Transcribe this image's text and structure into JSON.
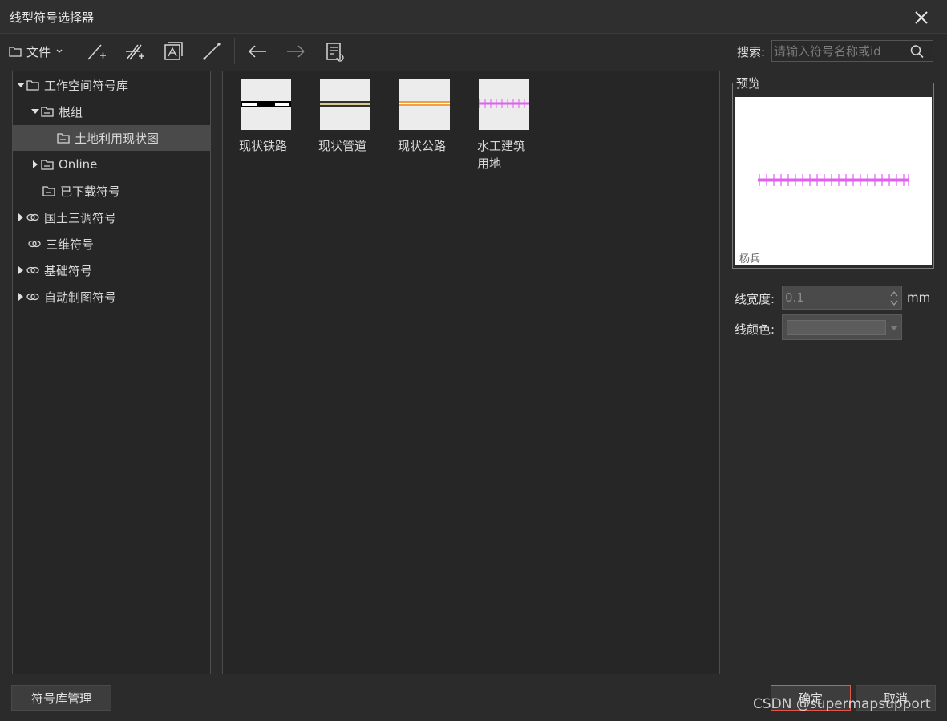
{
  "window": {
    "title": "线型符号选择器",
    "close_icon": "close-icon"
  },
  "toolbar": {
    "file_label": "文件",
    "icons": [
      "new-line-symbol-icon",
      "new-multi-line-symbol-icon",
      "import-symbol-icon",
      "edit-line-icon",
      "back-arrow-icon",
      "forward-arrow-icon",
      "properties-icon"
    ],
    "search_label": "搜索:",
    "search_placeholder": "请输入符号名称或id"
  },
  "tree": {
    "items": [
      {
        "label": "工作空间符号库",
        "expanded": true,
        "type": "folder"
      },
      {
        "label": "根组",
        "expanded": true,
        "type": "folder"
      },
      {
        "label": "土地利用现状图",
        "selected": true,
        "type": "folder"
      },
      {
        "label": "Online",
        "expanded": false,
        "type": "folder"
      },
      {
        "label": "已下载符号",
        "type": "folder"
      },
      {
        "label": "国土三调符号",
        "expanded": false,
        "type": "link"
      },
      {
        "label": "三维符号",
        "type": "link"
      },
      {
        "label": "基础符号",
        "expanded": false,
        "type": "link"
      },
      {
        "label": "自动制图符号",
        "expanded": false,
        "type": "link"
      }
    ]
  },
  "symbols": [
    {
      "label": "现状铁路"
    },
    {
      "label": "现状管道"
    },
    {
      "label": "现状公路"
    },
    {
      "label": "水工建筑用地"
    }
  ],
  "preview": {
    "title": "预览",
    "author": "杨兵",
    "line_color": "#e060f0"
  },
  "properties": {
    "width_label": "线宽度:",
    "width_value": "0.1",
    "width_unit": "mm",
    "color_label": "线颜色:"
  },
  "buttons": {
    "manage": "符号库管理",
    "ok": "确定",
    "cancel": "取消"
  },
  "watermark": "CSDN @supermapsupport"
}
